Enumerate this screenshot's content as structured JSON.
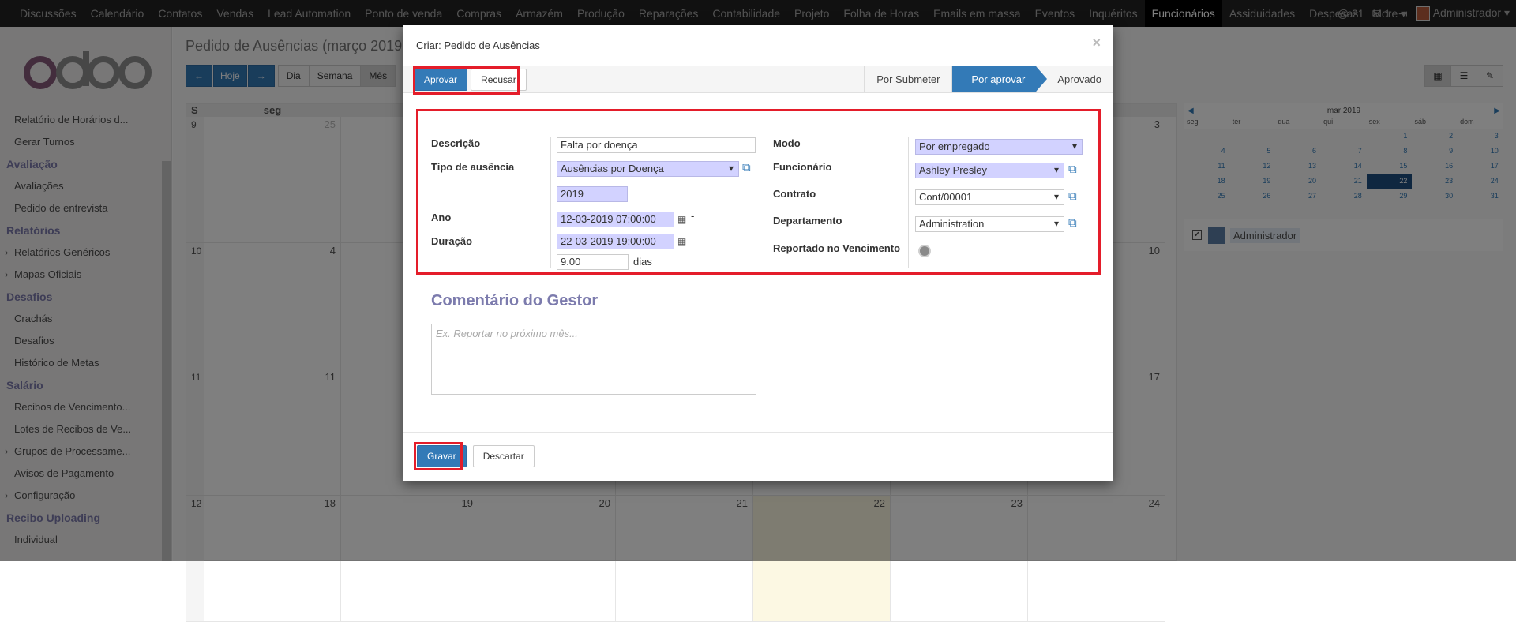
{
  "top_menu": [
    "Discussões",
    "Calendário",
    "Contatos",
    "Vendas",
    "Lead Automation",
    "Ponto de venda",
    "Compras",
    "Armazém",
    "Produção",
    "Reparações",
    "Contabilidade",
    "Projeto",
    "Folha de Horas",
    "Emails em massa",
    "Eventos",
    "Inquéritos",
    "Funcionários",
    "Assiduidades",
    "Despesas",
    "More ▾"
  ],
  "top_menu_active": "Funcionários",
  "top_right": {
    "messages_count": "21",
    "chat_count": "1",
    "user_name": "Administrador ▾"
  },
  "logo_text": "odoo",
  "sidebar": [
    {
      "type": "item",
      "label": "Relatório de Horários d..."
    },
    {
      "type": "item",
      "label": "Gerar Turnos"
    },
    {
      "type": "section",
      "label": "Avaliação"
    },
    {
      "type": "item",
      "label": "Avaliações"
    },
    {
      "type": "item",
      "label": "Pedido de entrevista"
    },
    {
      "type": "section",
      "label": "Relatórios"
    },
    {
      "type": "item",
      "label": "Relatórios Genéricos",
      "caret": true
    },
    {
      "type": "item",
      "label": "Mapas Oficiais",
      "caret": true
    },
    {
      "type": "section",
      "label": "Desafios"
    },
    {
      "type": "item",
      "label": "Crachás"
    },
    {
      "type": "item",
      "label": "Desafios"
    },
    {
      "type": "item",
      "label": "Histórico de Metas"
    },
    {
      "type": "section",
      "label": "Salário"
    },
    {
      "type": "item",
      "label": "Recibos de Vencimento..."
    },
    {
      "type": "item",
      "label": "Lotes de Recibos de Ve..."
    },
    {
      "type": "item",
      "label": "Grupos de Processame...",
      "caret": true
    },
    {
      "type": "item",
      "label": "Avisos de Pagamento"
    },
    {
      "type": "item",
      "label": "Configuração",
      "caret": true
    },
    {
      "type": "section",
      "label": "Recibo Uploading"
    },
    {
      "type": "item",
      "label": "Individual"
    }
  ],
  "background": {
    "page_title": "Pedido de Ausências (março 2019",
    "nav": {
      "prev": "←",
      "today": "Hoje",
      "next": "→",
      "day": "Dia",
      "week": "Semana",
      "month": "Mês"
    },
    "calendar_header": {
      "week_col": "S",
      "first_day": "seg"
    },
    "weeks": [
      "9",
      "10",
      "11",
      "12"
    ],
    "first_col_days": [
      "25",
      "4",
      "11",
      "18"
    ],
    "visible_days": [
      {
        "week": 2,
        "label": "11"
      },
      {
        "week": 3,
        "label": "18"
      },
      {
        "week": 3,
        "label": "19"
      },
      {
        "week": 3,
        "label": "20"
      },
      {
        "week": 3,
        "label": "21"
      },
      {
        "week": 3,
        "label": "22"
      },
      {
        "week": 3,
        "label": "23"
      },
      {
        "week": 3,
        "label": "24"
      }
    ],
    "right_col_days": [
      "3",
      "10",
      "17"
    ],
    "mini_calendar": {
      "title": "mar 2019",
      "dow": [
        "seg",
        "ter",
        "qua",
        "qui",
        "sex",
        "sáb",
        "dom"
      ],
      "rows": [
        [
          "",
          "",
          "",
          "",
          "1",
          "2",
          "3"
        ],
        [
          "4",
          "5",
          "6",
          "7",
          "8",
          "9",
          "10"
        ],
        [
          "11",
          "12",
          "13",
          "14",
          "15",
          "16",
          "17"
        ],
        [
          "18",
          "19",
          "20",
          "21",
          "22",
          "23",
          "24"
        ],
        [
          "25",
          "26",
          "27",
          "28",
          "29",
          "30",
          "31"
        ]
      ],
      "selected": "22"
    },
    "attendee": "Administrador"
  },
  "modal": {
    "title": "Criar: Pedido de Ausências",
    "close": "×",
    "actions": {
      "approve": "Aprovar",
      "refuse": "Recusar"
    },
    "stages": [
      "Por Submeter",
      "Por aprovar",
      "Aprovado"
    ],
    "current_stage": "Por aprovar",
    "form": {
      "descricao": {
        "label": "Descrição",
        "value": "Falta por doença"
      },
      "tipo": {
        "label": "Tipo de ausência",
        "value": "Ausências por Doença"
      },
      "ano": {
        "label": "Ano",
        "value": "2019"
      },
      "duracao": {
        "label": "Duração",
        "start": "12-03-2019 07:00:00",
        "end": "22-03-2019 19:00:00",
        "sep": "-",
        "days": "9.00",
        "unit": "dias"
      },
      "modo": {
        "label": "Modo",
        "value": "Por empregado"
      },
      "funcionario": {
        "label": "Funcionário",
        "value": "Ashley Presley"
      },
      "contrato": {
        "label": "Contrato",
        "value": "Cont/00001"
      },
      "departamento": {
        "label": "Departamento",
        "value": "Administration"
      },
      "reportado": {
        "label": "Reportado no Vencimento"
      }
    },
    "comment": {
      "title": "Comentário do Gestor",
      "placeholder": "Ex. Reportar no próximo mês..."
    },
    "footer": {
      "save": "Gravar",
      "discard": "Descartar"
    }
  }
}
